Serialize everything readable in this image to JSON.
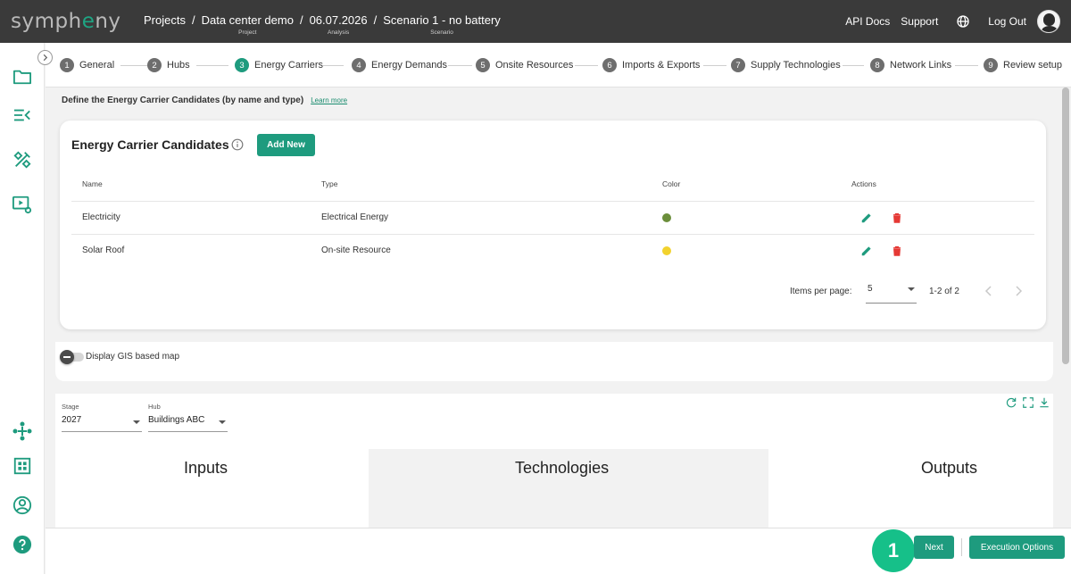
{
  "app": {
    "logo_text_start": "symph",
    "logo_text_mid": "e",
    "logo_text_end": "ny",
    "accent_color": "#1e9b7e"
  },
  "breadcrumbs": [
    {
      "title": "Projects",
      "sub": ""
    },
    {
      "title": "Data center demo",
      "sub": "Project"
    },
    {
      "title": "06.07.2026",
      "sub": "Analysis"
    },
    {
      "title": "Scenario 1 - no battery",
      "sub": "Scenario"
    }
  ],
  "breadcrumb_separator": "/",
  "header": {
    "api_docs": "API Docs",
    "support": "Support",
    "language_icon": "globe-icon",
    "logout": "Log Out"
  },
  "sidebar": {
    "icons": [
      "folder-icon",
      "menu-collapse-icon",
      "tools-icon",
      "video-settings-icon",
      "network-nodes-icon",
      "dashboard-grid-icon",
      "account-circle-icon",
      "help-circle-icon"
    ]
  },
  "steps": [
    {
      "num": "1",
      "label": "General"
    },
    {
      "num": "2",
      "label": "Hubs"
    },
    {
      "num": "3",
      "label": "Energy Carriers",
      "active": true
    },
    {
      "num": "4",
      "label": "Energy Demands"
    },
    {
      "num": "5",
      "label": "Onsite Resources"
    },
    {
      "num": "6",
      "label": "Imports & Exports"
    },
    {
      "num": "7",
      "label": "Supply Technologies"
    },
    {
      "num": "8",
      "label": "Network Links"
    },
    {
      "num": "9",
      "label": "Review setup"
    }
  ],
  "main": {
    "description": "Define the Energy Carrier Candidates (by name and type)",
    "learn_more": "Learn more"
  },
  "carriers": {
    "title": "Energy Carrier Candidates",
    "add_label": "Add New",
    "columns": {
      "name": "Name",
      "type": "Type",
      "color": "Color",
      "actions": "Actions"
    },
    "rows": [
      {
        "name": "Electricity",
        "type": "Electrical Energy",
        "color": "#6b8e3b"
      },
      {
        "name": "Solar Roof",
        "type": "On-site Resource",
        "color": "#f2d22e"
      }
    ],
    "items_per_page_label": "Items per page:",
    "items_per_page": "5",
    "range": "1-2 of 2",
    "edit_color": "#1e9b7e",
    "delete_color": "#e53935"
  },
  "gis": {
    "label": "Display GIS based map",
    "enabled": false
  },
  "diagram": {
    "stage_label": "Stage",
    "stage_value": "2027",
    "hub_label": "Hub",
    "hub_value": "Buildings ABC",
    "inputs": "Inputs",
    "technologies": "Technologies",
    "outputs": "Outputs"
  },
  "footer": {
    "badge": "1",
    "next": "Next",
    "execution_options": "Execution Options"
  }
}
